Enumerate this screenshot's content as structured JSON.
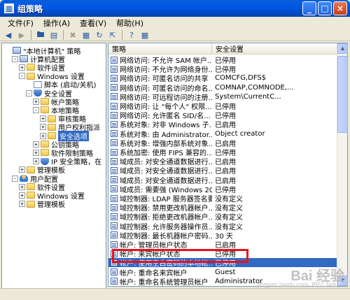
{
  "window": {
    "title": "组策略"
  },
  "menu": [
    "文件(F)",
    "操作(A)",
    "查看(V)",
    "帮助(H)"
  ],
  "tree": [
    {
      "label": "\"本地计算机\" 策略",
      "level": 0,
      "icon": "pc-icon",
      "exp": ""
    },
    {
      "label": "计算机配置",
      "level": 1,
      "icon": "pc-icon",
      "exp": "-"
    },
    {
      "label": "软件设置",
      "level": 2,
      "icon": "folder-icon",
      "exp": "+"
    },
    {
      "label": "Windows 设置",
      "level": 2,
      "icon": "folder-icon",
      "exp": "-"
    },
    {
      "label": "脚本 (启动/关机)",
      "level": 3,
      "icon": "document-icon",
      "exp": ""
    },
    {
      "label": "安全设置",
      "level": 3,
      "icon": "shield-icon",
      "exp": "-"
    },
    {
      "label": "帐户策略",
      "level": 4,
      "icon": "folder-icon",
      "exp": "+"
    },
    {
      "label": "本地策略",
      "level": 4,
      "icon": "folder-icon",
      "exp": "-"
    },
    {
      "label": "审核策略",
      "level": 5,
      "icon": "folder-icon",
      "exp": "+"
    },
    {
      "label": "用户权利指派",
      "level": 5,
      "icon": "folder-icon",
      "exp": "+"
    },
    {
      "label": "安全选项",
      "level": 5,
      "icon": "folder-icon",
      "exp": "+",
      "selected": true
    },
    {
      "label": "公钥策略",
      "level": 4,
      "icon": "folder-icon",
      "exp": "+"
    },
    {
      "label": "软件限制策略",
      "level": 4,
      "icon": "folder-icon",
      "exp": "+"
    },
    {
      "label": "IP 安全策略，在",
      "level": 4,
      "icon": "shield-icon",
      "exp": "+"
    },
    {
      "label": "管理模板",
      "level": 2,
      "icon": "folder-icon",
      "exp": "+"
    },
    {
      "label": "用户配置",
      "level": 1,
      "icon": "user-icon",
      "exp": "-"
    },
    {
      "label": "软件设置",
      "level": 2,
      "icon": "folder-icon",
      "exp": "+"
    },
    {
      "label": "Windows 设置",
      "level": 2,
      "icon": "folder-icon",
      "exp": "+"
    },
    {
      "label": "管理模板",
      "level": 2,
      "icon": "folder-icon",
      "exp": "+"
    }
  ],
  "columns": {
    "policy": "策略",
    "setting": "安全设置"
  },
  "rows": [
    {
      "policy": "网络访问: 不允许 SAM 帐户...",
      "setting": "已停用"
    },
    {
      "policy": "网络访问: 不允许为网络身份...",
      "setting": "已停用"
    },
    {
      "policy": "网络访问: 可匿名访问的共享",
      "setting": "COMCFG,DFS$"
    },
    {
      "policy": "网络访问: 可匿名访问的命名...",
      "setting": "COMNAP,COMNODE,..."
    },
    {
      "policy": "网络访问: 可远程访问的注册...",
      "setting": "System\\CurrentC..."
    },
    {
      "policy": "网络访问: 让 \"每个人\" 权限...",
      "setting": "已停用"
    },
    {
      "policy": "网络访问: 允许匿名 SID/名...",
      "setting": "已停用"
    },
    {
      "policy": "系统对象: 对非 Windows 子...",
      "setting": "已启用"
    },
    {
      "policy": "系统对象: 由 Administrator...",
      "setting": "Object creator"
    },
    {
      "policy": "系统对象: 增强内部系统对象...",
      "setting": "已启用"
    },
    {
      "policy": "系统加密: 使用 FIPS 兼容的...",
      "setting": "已停用"
    },
    {
      "policy": "域成员: 对安全通道数据进行...",
      "setting": "已启用"
    },
    {
      "policy": "域成员: 对安全通道数据进行...",
      "setting": "已启用"
    },
    {
      "policy": "域成员: 对安全通道数据进行...",
      "setting": "已启用"
    },
    {
      "policy": "域成员: 需要强 (Windows 20...",
      "setting": "已停用"
    },
    {
      "policy": "域控制器: LDAP 服务器签名要求",
      "setting": "没有定义"
    },
    {
      "policy": "域控制器: 禁用更改机器帐户...",
      "setting": "没有定义"
    },
    {
      "policy": "域控制器: 拒绝更改机器帐户...",
      "setting": "没有定义"
    },
    {
      "policy": "域控制器: 允许服务器操作员...",
      "setting": "没有定义"
    },
    {
      "policy": "域控制器: 最长机器帐户密码...",
      "setting": "30 天"
    },
    {
      "policy": "帐户: 管理员帐户状态",
      "setting": "已启用"
    },
    {
      "policy": "帐户: 来宾帐户状态",
      "setting": "已停用"
    },
    {
      "policy": "帐户: 使用空白密码的本地帐...",
      "setting": "已停用",
      "selected": true
    },
    {
      "policy": "帐户: 重命名来宾帐户",
      "setting": "Guest"
    },
    {
      "policy": "帐户: 重命名系统管理员帐户",
      "setting": "Administrator"
    }
  ],
  "watermark": {
    "brand": "Bai 经验",
    "site": "jingyan.baidu.com",
    "site2": "JB51.Net"
  }
}
